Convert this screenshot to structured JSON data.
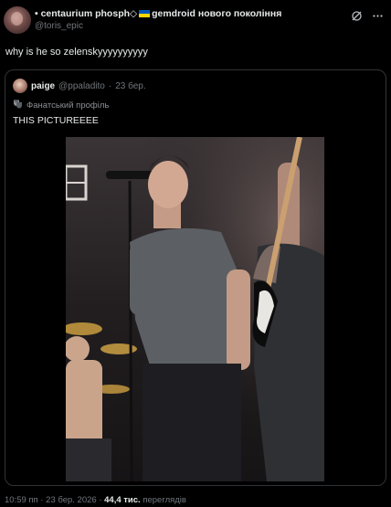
{
  "header": {
    "display_name_part1": "• centaurium phosph◇",
    "display_name_part2": "gemdroid нового покоління",
    "handle": "@toris_epic",
    "icons": [
      "grok-icon",
      "more-icon"
    ]
  },
  "tweet": {
    "text": "why is he so zelenskyyyyyyyyyy"
  },
  "quote": {
    "author_name": "paige",
    "author_handle": "@ppaladito",
    "separator": "·",
    "date": "23 бер.",
    "label": "Фанатський профіль",
    "text": "THIS PICTUREEEE"
  },
  "footer": {
    "time": "10:59 пп",
    "separator": "·",
    "date": "23 бер. 2026",
    "views_count": "44,4 тис.",
    "views_label": "переглядів"
  },
  "colors": {
    "background": "#000000",
    "text": "#e7e9ea",
    "muted": "#71767b",
    "border": "#2f3336"
  }
}
